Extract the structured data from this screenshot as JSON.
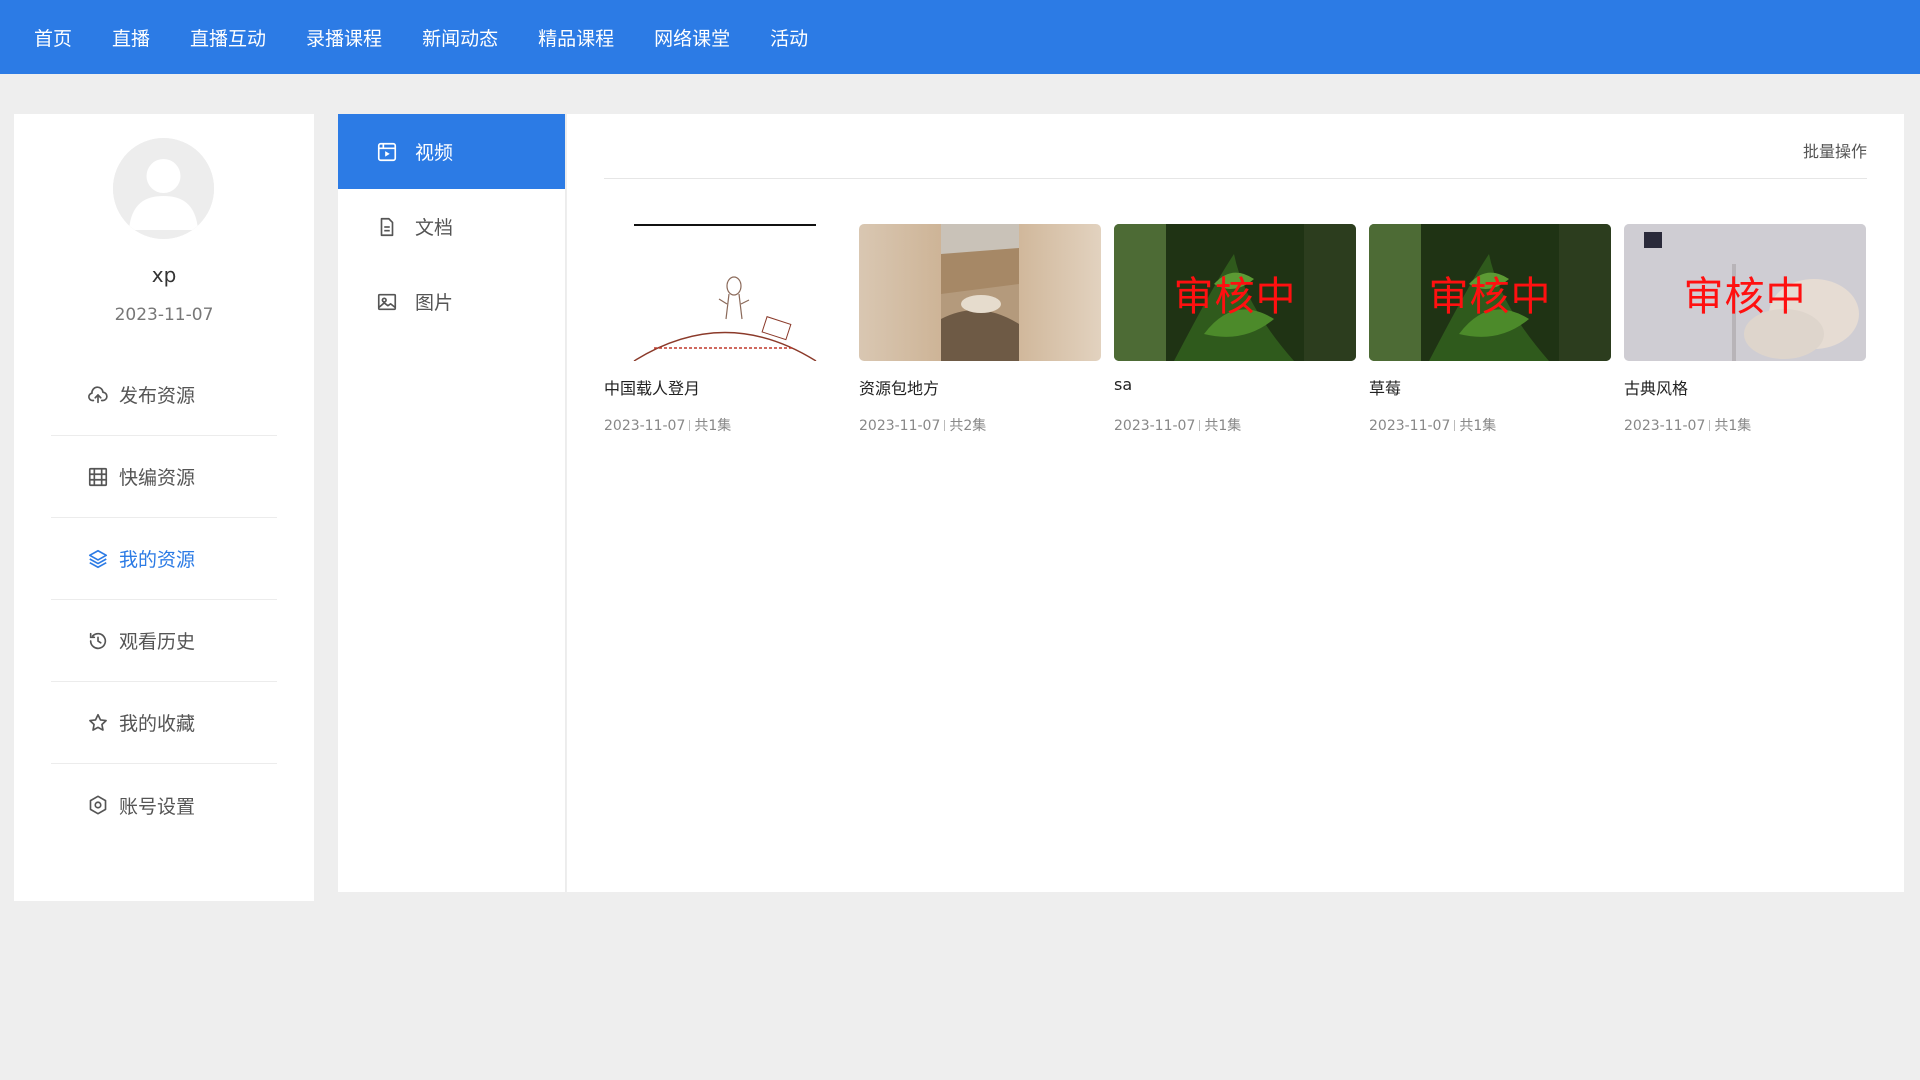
{
  "nav": {
    "items": [
      "首页",
      "直播",
      "直播互动",
      "录播课程",
      "新闻动态",
      "精品课程",
      "网络课堂",
      "活动"
    ]
  },
  "profile": {
    "username": "xp",
    "date": "2023-11-07"
  },
  "menu": {
    "items": [
      {
        "label": "发布资源",
        "icon": "cloud-upload-icon"
      },
      {
        "label": "快编资源",
        "icon": "film-grid-icon"
      },
      {
        "label": "我的资源",
        "icon": "layers-icon",
        "active": true
      },
      {
        "label": "观看历史",
        "icon": "history-icon"
      },
      {
        "label": "我的收藏",
        "icon": "star-icon"
      },
      {
        "label": "账号设置",
        "icon": "settings-icon"
      }
    ]
  },
  "subnav": {
    "items": [
      {
        "label": "视频",
        "icon": "video-icon",
        "active": true
      },
      {
        "label": "文档",
        "icon": "document-icon"
      },
      {
        "label": "图片",
        "icon": "image-icon"
      }
    ]
  },
  "main": {
    "batch_label": "批量操作",
    "cards": [
      {
        "title": "中国载人登月",
        "date": "2023-11-07",
        "count": "共1集",
        "review": ""
      },
      {
        "title": "资源包地方",
        "date": "2023-11-07",
        "count": "共2集",
        "review": ""
      },
      {
        "title": "sa",
        "date": "2023-11-07",
        "count": "共1集",
        "review": "审核中"
      },
      {
        "title": "草莓",
        "date": "2023-11-07",
        "count": "共1集",
        "review": "审核中"
      },
      {
        "title": "古典风格",
        "date": "2023-11-07",
        "count": "共1集",
        "review": "审核中"
      }
    ]
  },
  "colors": {
    "accent": "#2c7be5",
    "review_text": "#ff1010",
    "background": "#eeeeee"
  }
}
